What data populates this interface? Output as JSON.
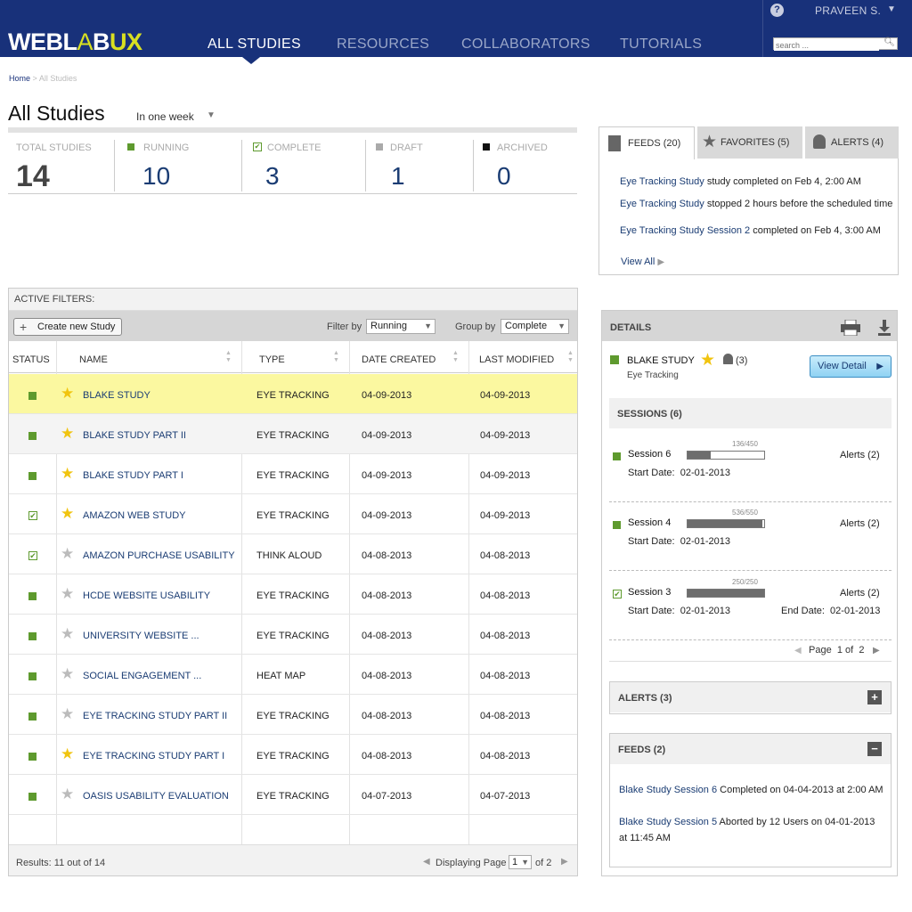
{
  "header": {
    "logo": {
      "part1": "WEBL",
      "part2": "A",
      "part3": "B",
      "part4": "UX"
    },
    "nav": [
      "ALL STUDIES",
      "RESOURCES",
      "COLLABORATORS",
      "TUTORIALS"
    ],
    "help": "?",
    "user": "PRAVEEN S.",
    "search_placeholder": "search ..."
  },
  "breadcrumb": {
    "home": "Home",
    "sep": ">",
    "current": "All Studies"
  },
  "page": {
    "title": "All Studies",
    "period": "In one week"
  },
  "stats": [
    {
      "label": "TOTAL STUDIES",
      "value": "14",
      "color": ""
    },
    {
      "label": "RUNNING",
      "value": "10",
      "color": "#5e9a2e"
    },
    {
      "label": "COMPLETE",
      "value": "3",
      "color": "#5e9a2e"
    },
    {
      "label": "DRAFT",
      "value": "1",
      "color": "#aaaaaa"
    },
    {
      "label": "ARCHIVED",
      "value": "0",
      "color": "#111111"
    }
  ],
  "tabs": {
    "feeds": "FEEDS (20)",
    "favorites": "FAVORITES (5)",
    "alerts": "ALERTS (4)"
  },
  "feeds": [
    {
      "link": "Eye Tracking Study",
      "text": " study completed on Feb 4, 2:00 AM"
    },
    {
      "link": "Eye Tracking Study",
      "text": " stopped 2 hours before the scheduled time"
    },
    {
      "link": "Eye Tracking Study Session 2",
      "text": " completed on Feb 4, 3:00 AM"
    }
  ],
  "view_all": "View All",
  "table": {
    "active_filters": "ACTIVE FILTERS:",
    "create_button": "Create new Study",
    "filter_by_label": "Filter by",
    "filter_by_value": "Running",
    "group_by_label": "Group by",
    "group_by_value": "Complete",
    "columns": [
      "STATUS",
      "NAME",
      "TYPE",
      "DATE CREATED",
      "LAST MODIFIED"
    ],
    "rows": [
      {
        "status": "running",
        "fav": true,
        "name": "BLAKE STUDY",
        "type": "EYE TRACKING",
        "created": "04-09-2013",
        "modified": "04-09-2013"
      },
      {
        "status": "running",
        "fav": true,
        "name": "BLAKE STUDY PART II",
        "type": "EYE TRACKING",
        "created": "04-09-2013",
        "modified": "04-09-2013"
      },
      {
        "status": "running",
        "fav": true,
        "name": "BLAKE STUDY PART I",
        "type": "EYE TRACKING",
        "created": "04-09-2013",
        "modified": "04-09-2013"
      },
      {
        "status": "complete",
        "fav": true,
        "name": "AMAZON WEB STUDY",
        "type": "EYE TRACKING",
        "created": "04-09-2013",
        "modified": "04-09-2013"
      },
      {
        "status": "complete",
        "fav": false,
        "name": "AMAZON PURCHASE USABILITY",
        "type": "THINK ALOUD",
        "created": "04-08-2013",
        "modified": "04-08-2013"
      },
      {
        "status": "running",
        "fav": false,
        "name": "HCDE WEBSITE USABILITY",
        "type": "EYE TRACKING",
        "created": "04-08-2013",
        "modified": "04-08-2013"
      },
      {
        "status": "running",
        "fav": false,
        "name": "UNIVERSITY WEBSITE ...",
        "type": "EYE TRACKING",
        "created": "04-08-2013",
        "modified": "04-08-2013"
      },
      {
        "status": "running",
        "fav": false,
        "name": "SOCIAL ENGAGEMENT ...",
        "type": "HEAT MAP",
        "created": "04-08-2013",
        "modified": "04-08-2013"
      },
      {
        "status": "running",
        "fav": false,
        "name": "EYE TRACKING STUDY PART II",
        "type": "EYE TRACKING",
        "created": "04-08-2013",
        "modified": "04-08-2013"
      },
      {
        "status": "running",
        "fav": true,
        "name": "EYE TRACKING STUDY PART I",
        "type": "EYE TRACKING",
        "created": "04-08-2013",
        "modified": "04-08-2013"
      },
      {
        "status": "running",
        "fav": false,
        "name": "OASIS USABILITY EVALUATION",
        "type": "EYE TRACKING",
        "created": "04-07-2013",
        "modified": "04-07-2013"
      }
    ],
    "results": "Results: 11 out of 14",
    "displaying": "Displaying Page",
    "page": "1",
    "of": "of 2"
  },
  "details": {
    "title": "DETAILS",
    "study_name": "BLAKE STUDY",
    "alerts_count": "(3)",
    "study_type": "Eye Tracking",
    "view_detail": "View Detail",
    "sessions_title": "SESSIONS (6)",
    "sessions": [
      {
        "name": "Session 6",
        "count": "136/450",
        "progress": 0.302,
        "alerts": "Alerts (2)",
        "start_label": "Start Date:",
        "start": "02-01-2013",
        "end_label": "",
        "end": "",
        "status": "running"
      },
      {
        "name": "Session 4",
        "count": "536/550",
        "progress": 0.975,
        "alerts": "Alerts (2)",
        "start_label": "Start Date:",
        "start": "02-01-2013",
        "end_label": "",
        "end": "",
        "status": "running"
      },
      {
        "name": "Session 3",
        "count": "250/250",
        "progress": 1.0,
        "alerts": "Alerts (2)",
        "start_label": "Start Date:",
        "start": "02-01-2013",
        "end_label": "End Date:",
        "end": "02-01-2013",
        "status": "complete"
      }
    ],
    "pager": {
      "page_label": "Page",
      "page": "1",
      "of": "of",
      "total": "2"
    },
    "alerts_box": "ALERTS (3)",
    "feeds_box": "FEEDS (2)",
    "feed_items": [
      {
        "link": "Blake Study Session 6",
        "text": " Completed on 04-04-2013 at 2:00 AM"
      },
      {
        "link": "Blake Study Session 5",
        "text": " Aborted by 12 Users  on 04-01-2013",
        "text2": "at 11:45 AM"
      }
    ]
  }
}
